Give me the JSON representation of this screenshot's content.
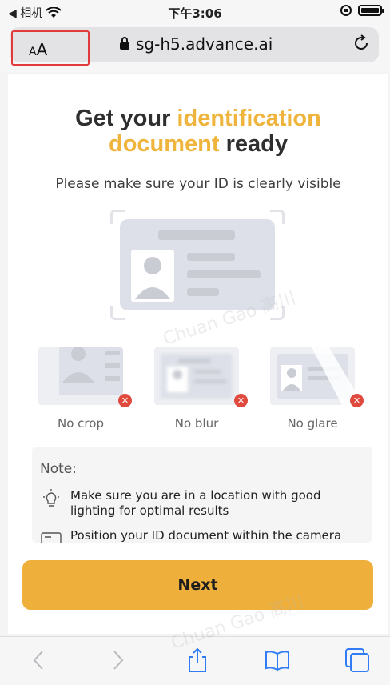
{
  "status_bar": {
    "back_label": "◀ 相机",
    "time": "下午3:06"
  },
  "address_bar": {
    "text_size_button": "AA",
    "url": "sg-h5.advance.ai"
  },
  "page": {
    "headline_part1": "Get your ",
    "headline_highlight1": "identification",
    "headline_highlight2": "document",
    "headline_part2": " ready",
    "subtitle": "Please make sure your ID is clearly visible",
    "examples": [
      {
        "label": "No crop"
      },
      {
        "label": "No blur"
      },
      {
        "label": "No glare"
      }
    ],
    "notes_title": "Note:",
    "notes": [
      {
        "icon": "lightbulb-icon",
        "text": "Make sure you are in a location with good lighting for optimal results"
      },
      {
        "icon": "id-card-icon",
        "text": "Position your ID document within the camera"
      }
    ],
    "next_button": "Next"
  },
  "watermark": "Chuan Gao 高川",
  "colors": {
    "accent": "#eeaf3b",
    "highlight_text": "#eeb43c",
    "error_badge": "#e0493d",
    "annotation_box": "#e03a3a"
  }
}
